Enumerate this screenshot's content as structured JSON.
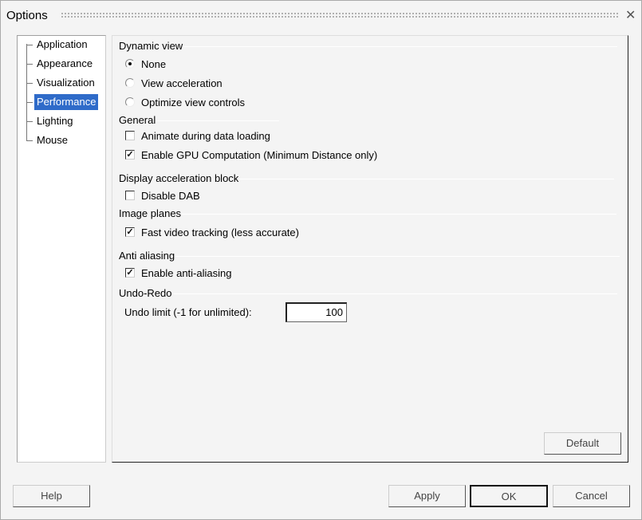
{
  "window": {
    "title": "Options",
    "close_icon": "close-icon"
  },
  "tree": {
    "items": [
      {
        "label": "Application",
        "selected": false
      },
      {
        "label": "Appearance",
        "selected": false
      },
      {
        "label": "Visualization",
        "selected": false
      },
      {
        "label": "Performance",
        "selected": true
      },
      {
        "label": "Lighting",
        "selected": false
      },
      {
        "label": "Mouse",
        "selected": false
      }
    ]
  },
  "sections": {
    "dynamic_view": {
      "title": "Dynamic view",
      "options": [
        {
          "label": "None",
          "selected": true
        },
        {
          "label": "View acceleration",
          "selected": false
        },
        {
          "label": "Optimize view controls",
          "selected": false
        }
      ]
    },
    "general": {
      "title": "General",
      "options": [
        {
          "label": "Animate during data loading",
          "checked": false
        },
        {
          "label": "Enable GPU Computation (Minimum Distance only)",
          "checked": true
        }
      ]
    },
    "dab": {
      "title": "Display acceleration block",
      "options": [
        {
          "label": "Disable DAB",
          "checked": false
        }
      ]
    },
    "image_planes": {
      "title": "Image planes",
      "options": [
        {
          "label": "Fast video tracking (less accurate)",
          "checked": true
        }
      ]
    },
    "anti_aliasing": {
      "title": "Anti aliasing",
      "options": [
        {
          "label": "Enable anti-aliasing",
          "checked": true
        }
      ]
    },
    "undo_redo": {
      "title": "Undo-Redo",
      "undo_limit_label": "Undo limit (-1 for unlimited):",
      "undo_limit_value": "100"
    }
  },
  "buttons": {
    "default": "Default",
    "help": "Help",
    "apply": "Apply",
    "ok": "OK",
    "cancel": "Cancel"
  },
  "colors": {
    "selection": "#2f6bc9"
  }
}
